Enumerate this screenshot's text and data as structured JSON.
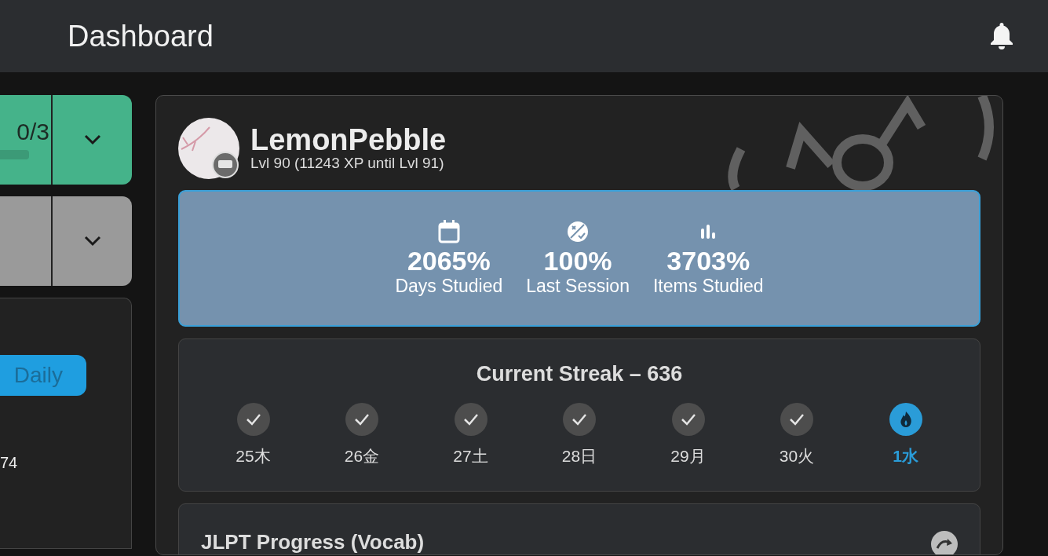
{
  "header": {
    "title": "Dashboard"
  },
  "left_panel": {
    "goals": [
      {
        "color": "#45b38a",
        "count": "0/3",
        "level": 0
      },
      {
        "color": "#9a9a9a"
      }
    ],
    "card": {
      "tab": {
        "label": "Daily",
        "selected": true
      },
      "value": "74"
    }
  },
  "profile": {
    "name": "LemonPebble",
    "level_text": "Lvl 90 (11243 XP until Lvl 91)"
  },
  "stats": [
    {
      "kind": "calendar",
      "value": "2065%",
      "label": "Days Studied"
    },
    {
      "kind": "session",
      "value": "100%",
      "label": "Last Session"
    },
    {
      "kind": "chart",
      "value": "3703%",
      "label": "Items Studied"
    }
  ],
  "streak": {
    "title": "Current Streak – 636",
    "days": [
      {
        "label": "25木",
        "kind": "done"
      },
      {
        "label": "26金",
        "kind": "done"
      },
      {
        "label": "27土",
        "kind": "done"
      },
      {
        "label": "28日",
        "kind": "done"
      },
      {
        "label": "29月",
        "kind": "done"
      },
      {
        "label": "30火",
        "kind": "done"
      },
      {
        "label": "1水",
        "kind": "today"
      }
    ]
  },
  "jlpt": {
    "title": "JLPT Progress (Vocab)"
  }
}
